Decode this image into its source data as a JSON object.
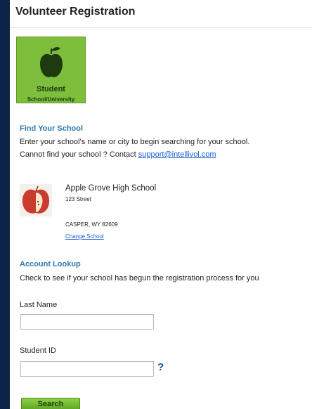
{
  "header": {
    "title": "Volunteer Registration"
  },
  "role": {
    "title": "Student",
    "subtitle": "School/University",
    "icon": "apple-icon"
  },
  "find_school": {
    "title": "Find Your School",
    "line1": "Enter your school's name or city to begin searching for your school.",
    "line2_prefix": "Cannot find your school ? Contact ",
    "support_email": "support@intellivol.com"
  },
  "school": {
    "name": "Apple Grove High School",
    "street": "123 Street",
    "city_state_zip": "CASPER, WY 82609",
    "change_label": "Change School"
  },
  "account_lookup": {
    "title": "Account Lookup",
    "description": "Check to see if your school has begun the registration process for you",
    "last_name_label": "Last Name",
    "last_name_value": "",
    "student_id_label": "Student ID",
    "student_id_value": "",
    "help_glyph": "?",
    "search_label": "Search"
  },
  "colors": {
    "background": "#0b2447",
    "accent": "#2b7bb6",
    "button": "#6cb82e"
  }
}
